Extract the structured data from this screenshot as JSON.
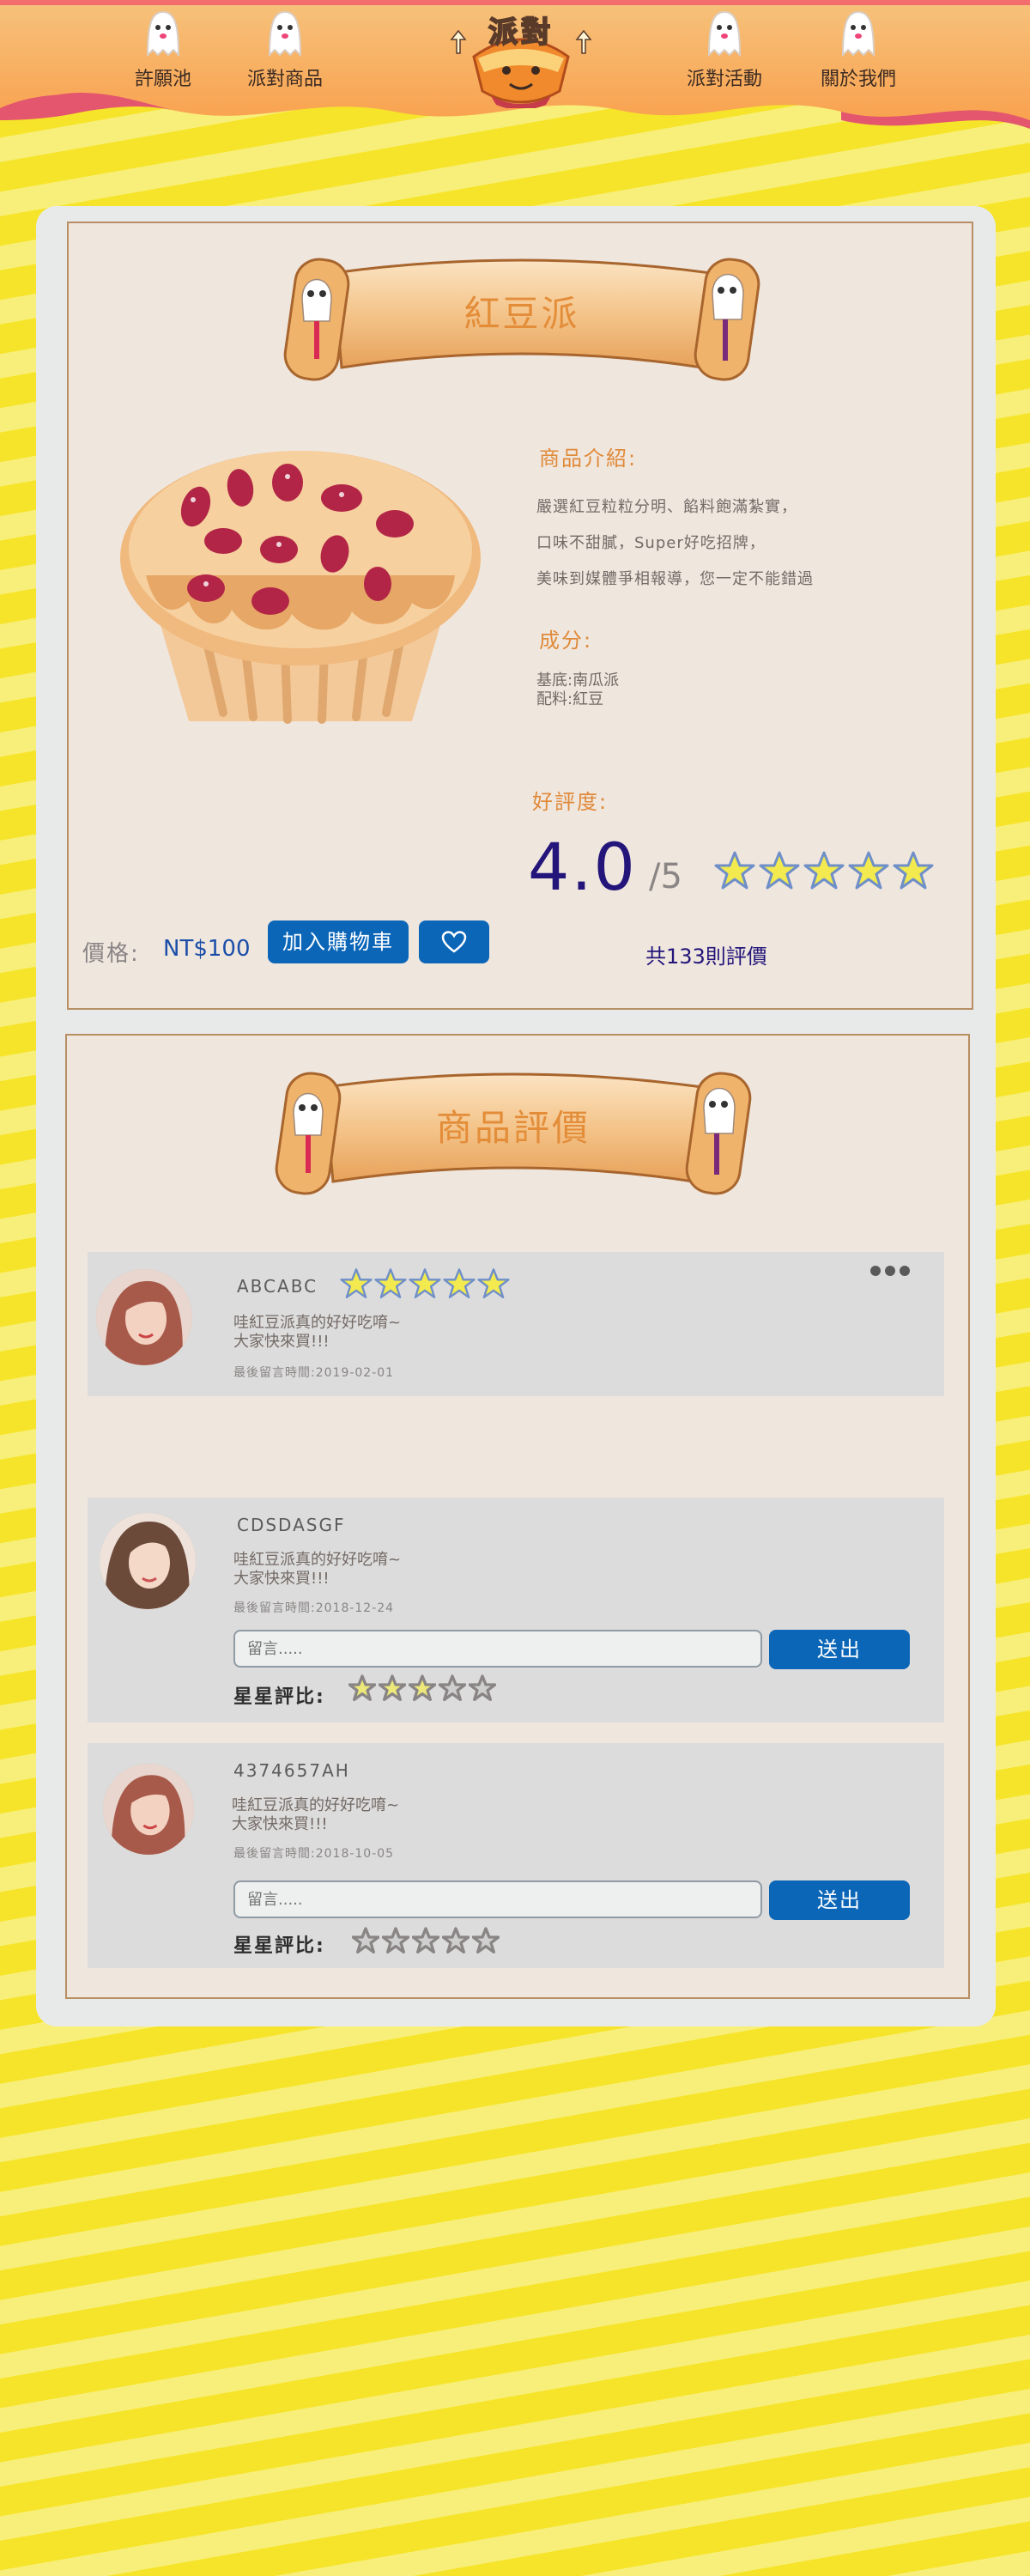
{
  "nav": {
    "items": [
      {
        "label": "許願池"
      },
      {
        "label": "派對商品"
      },
      {
        "label": "派對活動"
      },
      {
        "label": "關於我們"
      }
    ],
    "logo_text": "派對"
  },
  "product": {
    "title": "紅豆派",
    "intro_title": "商品介紹:",
    "intro_lines": [
      "嚴選紅豆粒粒分明、餡料飽滿紮實，",
      "口味不甜膩，Super好吃招牌，",
      "美味到媒體爭相報導，您一定不能錯過"
    ],
    "ingredients_title": "成分:",
    "ingredients": [
      "基底:南瓜派",
      "配料:紅豆"
    ],
    "rating_title": "好評度:",
    "rating_score": "4.0",
    "rating_outof": "/5",
    "rating_stars": 5,
    "reviews_count_text": "共133則評價",
    "price_label": "價格:",
    "price_value": "NT$100",
    "add_cart_label": "加入購物車"
  },
  "reviews_section": {
    "title": "商品評價",
    "reviews": [
      {
        "name": "ABCABC",
        "lines": [
          "哇紅豆派真的好好吃唷~",
          "大家快來買!!!"
        ],
        "time": "最後留言時間:2019-02-01",
        "stars": 5
      },
      {
        "name": "CDSDASGF",
        "lines": [
          "哇紅豆派真的好好吃唷~",
          "大家快來買!!!"
        ],
        "time": "最後留言時間:2018-12-24",
        "comment_placeholder": "留言.....",
        "send_label": "送出",
        "rate_label": "星星評比:",
        "given_stars": 3
      },
      {
        "name": "4374657AH",
        "lines": [
          "哇紅豆派真的好好吃唷~",
          "大家快來買!!!"
        ],
        "time": "最後留言時間:2018-10-05",
        "comment_placeholder": "留言.....",
        "send_label": "送出",
        "rate_label": "星星評比:",
        "given_stars": 0
      }
    ]
  },
  "colors": {
    "accent_blue": "#0b66b8",
    "title_orange": "#e38d39",
    "score_navy": "#23157a",
    "card_bg": "#efe6de",
    "page_yellow": "#f6e42a"
  }
}
